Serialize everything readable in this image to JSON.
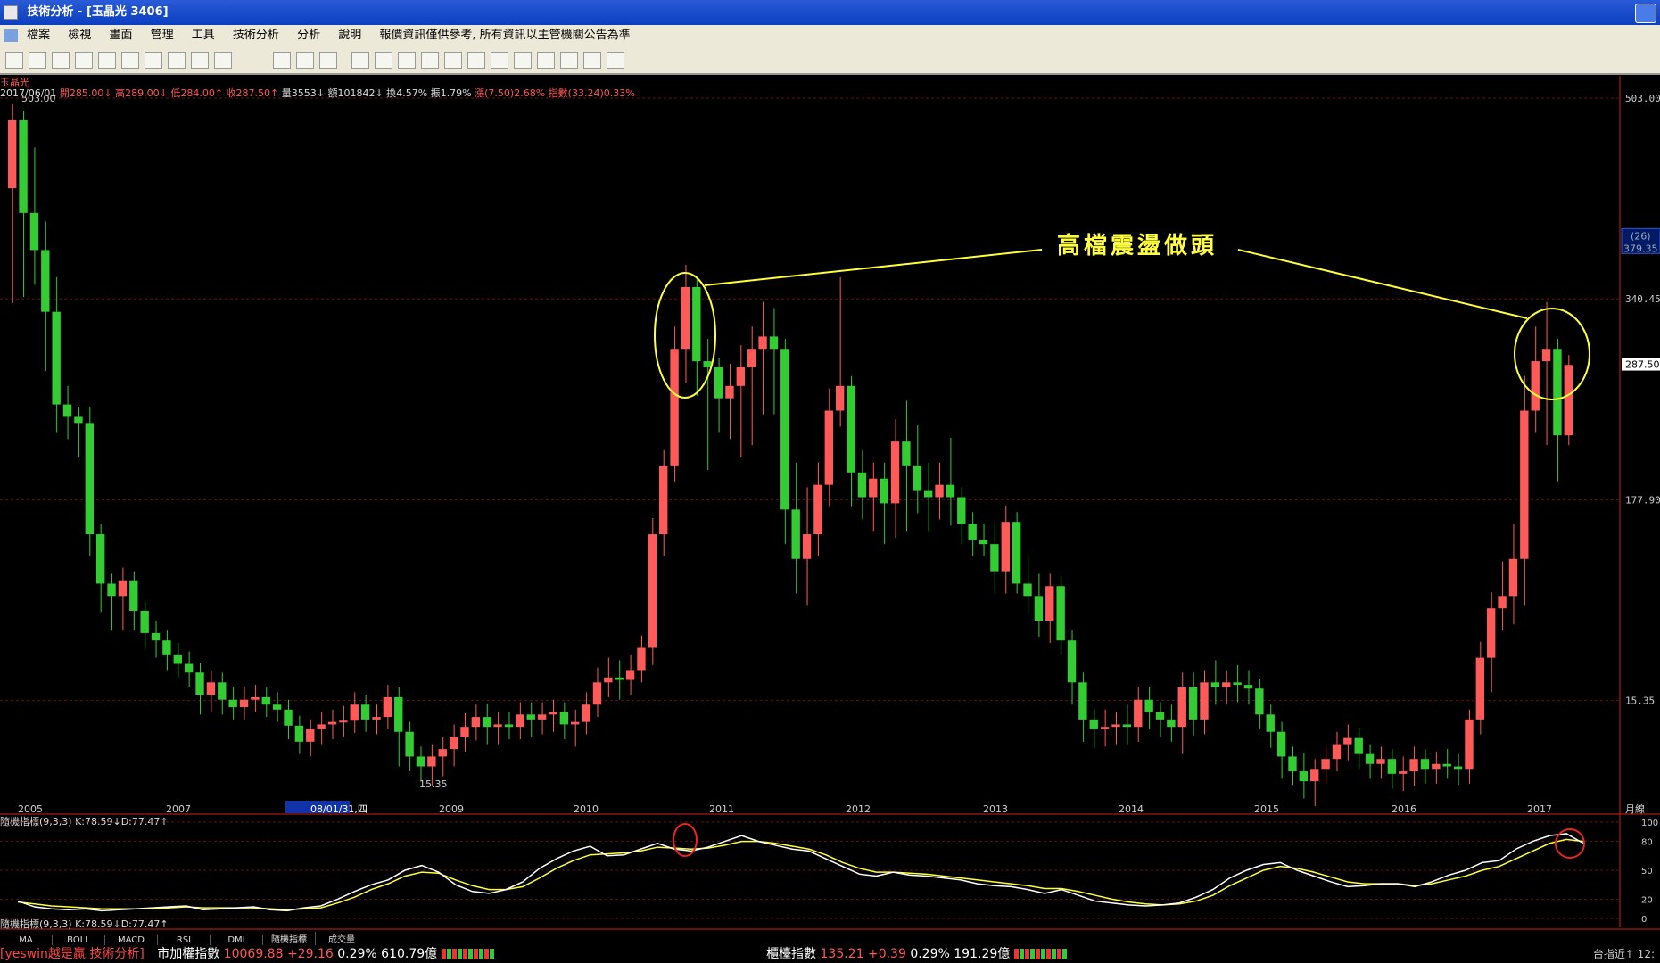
{
  "window": {
    "title": "技術分析 - [玉晶光 3406]"
  },
  "menu": [
    "檔案",
    "檢視",
    "畫面",
    "管理",
    "工具",
    "技術分析",
    "分析",
    "說明",
    "報價資訊僅供參考, 所有資訊以主管機關公告為準"
  ],
  "stock": {
    "name": "玉晶光",
    "date": "2017/06/01",
    "open": "開285.00↓",
    "high": "高289.00↓",
    "low": "低284.00↑",
    "close": "收287.50↑",
    "volume": "量3553↓",
    "amount": "額101842↓",
    "turnover": "換4.57%",
    "amplitude": "振1.79%",
    "change": "漲(7.50)2.68%",
    "index": "指數(33.24)0.33%"
  },
  "price_axis": {
    "labels": [
      "503.00",
      "340.45",
      "177.90",
      "15.35"
    ],
    "current": "287.50",
    "mark_count": "(26)",
    "mark_value": "379.35",
    "max_label": "503.00",
    "min_label": "15.35"
  },
  "x_axis": {
    "labels": [
      "2005",
      "2007",
      "08/01/31,四",
      "2009",
      "2010",
      "2011",
      "2012",
      "2013",
      "2014",
      "2015",
      "2016",
      "2017"
    ],
    "period": "月線"
  },
  "annotation": "高檔震盪做頭",
  "indicator": {
    "title": "隨機指標(9,3,3) K:78.59↓D:77.47↑",
    "title_bottom": "隨機指標(9,3,3) K:78.59↓D:77.47↑",
    "axis": [
      "100",
      "80",
      "50",
      "20",
      "0"
    ]
  },
  "tabs": [
    "MA",
    "BOLL",
    "MACD",
    "RSI",
    "DMI",
    "隨機指標",
    "成交量"
  ],
  "status": {
    "brand": "[yeswin越是贏 技術分析]",
    "taiex_label": "市加權指數",
    "taiex_value": "10069.88",
    "taiex_change": "+29.16",
    "taiex_pct": "0.29%",
    "taiex_amount": "610.79億",
    "otc_label": "櫃檯指數",
    "otc_value": "135.21",
    "otc_change": "+0.39",
    "otc_pct": "0.29%",
    "otc_amount": "191.29億",
    "right": "台指近↑  12:"
  },
  "colors": {
    "up": "#ff5a5a",
    "down": "#33cc33",
    "k_line": "#ffffff",
    "d_line": "#ffff33",
    "annotation": "#ffff40"
  },
  "chart_data": {
    "type": "candlestick",
    "title": "玉晶光 3406",
    "candles": [
      [
        430,
        490,
        345,
        485
      ],
      [
        485,
        470,
        350,
        410
      ],
      [
        410,
        455,
        360,
        380
      ],
      [
        380,
        395,
        290,
        330
      ],
      [
        330,
        350,
        240,
        255
      ],
      [
        255,
        262,
        235,
        245
      ],
      [
        245,
        235,
        220,
        240
      ],
      [
        240,
        245,
        140,
        150
      ],
      [
        150,
        140,
        95,
        110
      ],
      [
        110,
        100,
        80,
        100
      ],
      [
        100,
        115,
        80,
        112
      ],
      [
        112,
        85,
        80,
        88
      ],
      [
        88,
        82,
        65,
        70
      ],
      [
        70,
        72,
        58,
        64
      ],
      [
        64,
        60,
        48,
        52
      ],
      [
        52,
        54,
        42,
        45
      ],
      [
        45,
        47,
        34,
        38
      ],
      [
        38,
        38,
        12,
        20
      ],
      [
        20,
        31,
        14,
        30
      ],
      [
        30,
        28,
        12,
        16
      ],
      [
        16,
        18,
        8,
        10
      ],
      [
        10,
        18,
        8,
        16
      ],
      [
        16,
        20,
        14,
        18
      ],
      [
        18,
        18,
        10,
        12
      ],
      [
        12,
        14,
        6,
        8
      ],
      [
        8,
        0,
        -8,
        -5
      ],
      [
        -5,
        -15,
        -20,
        -18
      ],
      [
        -18,
        -10,
        -22,
        -8
      ],
      [
        -8,
        -2,
        -12,
        -4
      ],
      [
        -4,
        0,
        -8,
        -2
      ],
      [
        -2,
        3,
        -6,
        -1
      ],
      [
        -1,
        14,
        -3,
        12
      ],
      [
        12,
        2,
        -2,
        0
      ],
      [
        0,
        4,
        -4,
        2
      ],
      [
        2,
        20,
        0,
        18
      ],
      [
        18,
        -8,
        -30,
        -10
      ],
      [
        -10,
        -20,
        -34,
        -30
      ],
      [
        -30,
        -30,
        -42,
        -38
      ],
      [
        -38,
        -28,
        -46,
        -30
      ],
      [
        -30,
        -22,
        -38,
        -24
      ],
      [
        -24,
        -12,
        -30,
        -14
      ],
      [
        -14,
        -3,
        -18,
        -6
      ],
      [
        -6,
        4,
        -9,
        2
      ],
      [
        2,
        5,
        -12,
        -6
      ],
      [
        -6,
        -2,
        -12,
        -4
      ],
      [
        -4,
        -2,
        -8,
        -6
      ],
      [
        -6,
        6,
        -8,
        4
      ],
      [
        4,
        6,
        -6,
        0
      ],
      [
        0,
        6,
        -4,
        4
      ],
      [
        4,
        8,
        -2,
        6
      ],
      [
        6,
        -5,
        -8,
        -4
      ],
      [
        -4,
        0,
        -14,
        -2
      ],
      [
        -2,
        14,
        -4,
        12
      ],
      [
        12,
        34,
        10,
        30
      ],
      [
        30,
        42,
        26,
        34
      ],
      [
        34,
        40,
        24,
        32
      ],
      [
        32,
        44,
        28,
        40
      ],
      [
        40,
        60,
        38,
        58
      ],
      [
        58,
        155,
        52,
        150
      ],
      [
        150,
        210,
        140,
        205
      ],
      [
        205,
        310,
        200,
        300
      ],
      [
        300,
        360,
        280,
        350
      ],
      [
        350,
        285,
        270,
        290
      ],
      [
        290,
        300,
        210,
        285
      ],
      [
        285,
        265,
        240,
        260
      ],
      [
        260,
        280,
        235,
        270
      ],
      [
        270,
        295,
        220,
        285
      ],
      [
        285,
        310,
        230,
        300
      ],
      [
        300,
        330,
        255,
        310
      ],
      [
        310,
        325,
        255,
        300
      ],
      [
        300,
        300,
        150,
        170
      ],
      [
        170,
        200,
        110,
        130
      ],
      [
        130,
        180,
        100,
        150
      ],
      [
        150,
        200,
        140,
        190
      ],
      [
        190,
        260,
        180,
        250
      ],
      [
        250,
        350,
        245,
        270
      ],
      [
        270,
        260,
        180,
        200
      ],
      [
        200,
        210,
        170,
        180
      ],
      [
        180,
        200,
        160,
        195
      ],
      [
        195,
        200,
        150,
        175
      ],
      [
        175,
        235,
        155,
        225
      ],
      [
        225,
        250,
        160,
        205
      ],
      [
        205,
        230,
        175,
        185
      ],
      [
        185,
        200,
        160,
        180
      ],
      [
        180,
        200,
        170,
        190
      ],
      [
        190,
        220,
        165,
        180
      ],
      [
        180,
        170,
        150,
        158
      ],
      [
        158,
        160,
        140,
        145
      ],
      [
        145,
        150,
        140,
        142
      ],
      [
        142,
        150,
        110,
        120
      ],
      [
        120,
        165,
        110,
        160
      ],
      [
        160,
        160,
        110,
        110
      ],
      [
        110,
        125,
        95,
        100
      ],
      [
        100,
        110,
        75,
        80
      ],
      [
        80,
        110,
        70,
        108
      ],
      [
        108,
        100,
        60,
        64
      ],
      [
        64,
        50,
        20,
        30
      ],
      [
        30,
        12,
        -10,
        0
      ],
      [
        0,
        -5,
        -15,
        -8
      ],
      [
        -8,
        0,
        -14,
        -6
      ],
      [
        -6,
        -2,
        -12,
        -4
      ],
      [
        -4,
        4,
        -12,
        -6
      ],
      [
        -6,
        18,
        -10,
        16
      ],
      [
        16,
        18,
        0,
        6
      ],
      [
        6,
        2,
        -6,
        0
      ],
      [
        0,
        4,
        -10,
        -6
      ],
      [
        -6,
        30,
        -20,
        26
      ],
      [
        26,
        30,
        -5,
        0
      ],
      [
        0,
        32,
        -4,
        30
      ],
      [
        30,
        40,
        20,
        26
      ],
      [
        26,
        32,
        20,
        30
      ],
      [
        30,
        36,
        22,
        28
      ],
      [
        28,
        32,
        20,
        25
      ],
      [
        25,
        10,
        0,
        4
      ],
      [
        4,
        -5,
        -15,
        -10
      ],
      [
        -10,
        -20,
        -40,
        -30
      ],
      [
        -30,
        -30,
        -45,
        -42
      ],
      [
        -42,
        -35,
        -56,
        -50
      ],
      [
        -50,
        -40,
        -62,
        -40
      ],
      [
        -40,
        -30,
        -44,
        -32
      ],
      [
        -32,
        -18,
        -34,
        -20
      ],
      [
        -20,
        -12,
        -25,
        -15
      ],
      [
        -15,
        -25,
        -32,
        -28
      ],
      [
        -28,
        -34,
        -40,
        -36
      ],
      [
        -36,
        -30,
        -40,
        -32
      ],
      [
        -32,
        -40,
        -48,
        -44
      ],
      [
        -44,
        -38,
        -50,
        -42
      ],
      [
        -42,
        -30,
        -46,
        -32
      ],
      [
        -32,
        -34,
        -44,
        -40
      ],
      [
        -40,
        -34,
        -44,
        -36
      ],
      [
        -36,
        -32,
        -40,
        -38
      ],
      [
        -38,
        -36,
        -45,
        -40
      ],
      [
        -40,
        -5,
        -44,
        0
      ],
      [
        0,
        55,
        -4,
        50
      ],
      [
        50,
        95,
        30,
        90
      ],
      [
        90,
        120,
        80,
        100
      ],
      [
        100,
        150,
        85,
        130
      ],
      [
        130,
        270,
        100,
        250
      ],
      [
        250,
        310,
        240,
        290
      ],
      [
        290,
        330,
        230,
        300
      ],
      [
        300,
        296,
        200,
        230
      ],
      [
        230,
        287,
        230,
        287
      ]
    ],
    "y_range": [
      -60,
      503
    ],
    "y_ticks": [
      503.0,
      340.45,
      177.9,
      15.35
    ],
    "kd": {
      "K": [
        18,
        12,
        10,
        9,
        10,
        8,
        9,
        10,
        11,
        12,
        13,
        9,
        10,
        11,
        12,
        9,
        8,
        11,
        13,
        20,
        28,
        35,
        40,
        50,
        55,
        48,
        35,
        28,
        26,
        30,
        38,
        52,
        62,
        70,
        75,
        65,
        66,
        72,
        78,
        72,
        70,
        74,
        80,
        86,
        80,
        76,
        72,
        70,
        62,
        54,
        46,
        44,
        48,
        45,
        44,
        42,
        40,
        36,
        34,
        33,
        30,
        26,
        30,
        24,
        18,
        16,
        14,
        13,
        14,
        16,
        22,
        30,
        42,
        50,
        56,
        58,
        50,
        44,
        38,
        33,
        34,
        36,
        36,
        33,
        38,
        45,
        50,
        58,
        60,
        72,
        80,
        86,
        88,
        78
      ],
      "D": [
        17,
        15,
        13,
        12,
        11,
        10,
        10,
        10,
        10,
        11,
        12,
        11,
        11,
        11,
        11,
        10,
        9,
        10,
        11,
        16,
        22,
        30,
        36,
        44,
        48,
        47,
        40,
        34,
        30,
        30,
        33,
        42,
        52,
        60,
        66,
        67,
        68,
        70,
        74,
        73,
        72,
        73,
        76,
        80,
        80,
        78,
        75,
        72,
        66,
        58,
        52,
        48,
        48,
        47,
        46,
        44,
        42,
        40,
        38,
        36,
        34,
        31,
        31,
        28,
        24,
        20,
        17,
        15,
        14,
        15,
        18,
        24,
        34,
        42,
        50,
        54,
        52,
        48,
        43,
        38,
        36,
        36,
        36,
        34,
        36,
        40,
        44,
        50,
        54,
        62,
        70,
        78,
        82,
        80
      ]
    }
  }
}
